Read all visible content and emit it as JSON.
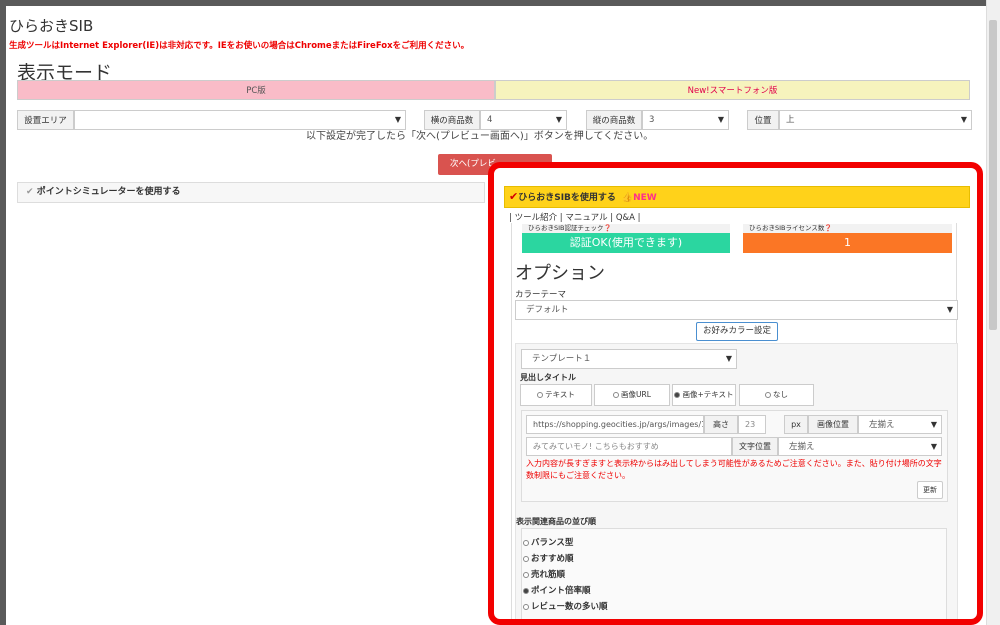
{
  "app_title": "ひらおきSIB",
  "warning": "生成ツールはInternet Explorer(IE)は非対応です。IEをお使いの場合はChromeまたはFireFoxをご利用ください。",
  "display_mode": {
    "title": "表示モード",
    "tabs": [
      "PC版",
      "New!スマートフォン版"
    ]
  },
  "settings": {
    "area_label": "設置エリア",
    "area_value": "",
    "cols_label": "横の商品数",
    "cols_value": "4",
    "rows_label": "縦の商品数",
    "rows_value": "3",
    "position_label": "位置",
    "position_value": "上"
  },
  "instruction": "以下設定が完了したら「次へ(プレビュー画面へ)」ボタンを押してください。",
  "next_button": "次へ(プレビ",
  "point_sim_label": "ポイントシミュレーターを使用する",
  "sib": {
    "header": "ひらおきSIBを使用する",
    "new_badge": "👍NEW",
    "links": "| ツール紹介 | マニュアル | Q&A |",
    "auth_label": "ひらおきSIB認証チェック❓",
    "auth_value": "認証OK(使用できます)",
    "license_label": "ひらおきSIBライセンス数❓",
    "license_value": "1",
    "option_title": "オプション",
    "color_theme_label": "カラーテーマ",
    "color_theme_value": "デフォルト",
    "fav_color_button": "お好みカラー設定",
    "template_value": "テンプレート１",
    "heading_title_label": "見出しタイトル",
    "heading_options": [
      "テキスト",
      "画像URL",
      "画像+テキスト",
      "なし"
    ],
    "image_url": "https://shopping.geocities.jp/args/images/16(",
    "height_label": "高さ",
    "height_value": "23",
    "px_label": "px",
    "image_pos_label": "画像位置",
    "image_pos_value": "左揃え",
    "text_placeholder": "みてみていモノ! こちらもおすすめ",
    "text_pos_label": "文字位置",
    "text_pos_value": "左揃え",
    "note": "入力内容が長すぎますと表示枠からはみ出してしまう可能性があるためご注意ください。また、貼り付け場所の文字数制限にもご注意ください。",
    "update_button": "更新",
    "sort_title": "表示関連商品の並び順",
    "sort_options": [
      "バランス型",
      "おすすめ順",
      "売れ筋順",
      "ポイント倍率順",
      "レビュー数の多い順"
    ],
    "sort_selected": "ポイント倍率順"
  },
  "colors": {
    "pc_tab": "#f9bcc8",
    "sp_tab": "#f6f3bd",
    "sib_header": "#ffd21a",
    "auth_ok": "#2bd6a0",
    "license": "#fb7625",
    "highlight_border": "#f20000",
    "next_button": "#d9534f"
  }
}
